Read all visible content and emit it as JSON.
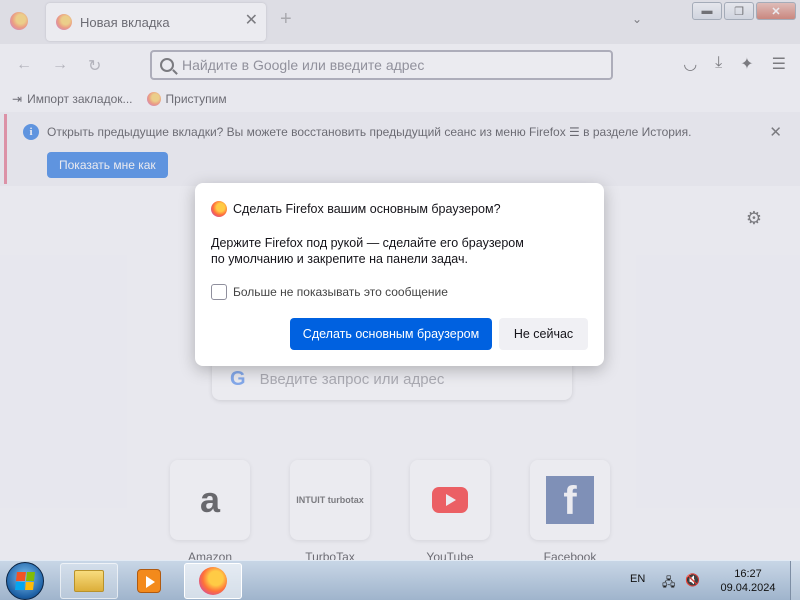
{
  "tabs": [
    {
      "title": "Новая вкладка",
      "close": "✕"
    }
  ],
  "tabbar": {
    "new_tab": "+",
    "tab_list": "⌄"
  },
  "window_controls": {
    "minimize": "▬",
    "maximize": "❐",
    "close": "✕"
  },
  "nav": {
    "back": "←",
    "forward": "→",
    "reload": "↻",
    "url_placeholder": "Найдите в Google или введите адрес",
    "pocket": "◡",
    "downloads": "⤓",
    "extensions": "✦",
    "menu": "☰"
  },
  "bookmarks": [
    {
      "label": "Импорт закладок...",
      "icon": "import-icon"
    },
    {
      "label": "Приступим",
      "icon": "firefox-icon"
    }
  ],
  "notification": {
    "text": "Открыть предыдущие вкладки? Вы можете восстановить предыдущий сеанс из меню Firefox ☰ в разделе История.",
    "info": "i",
    "button": "Показать мне как",
    "close": "✕"
  },
  "newtab": {
    "search_placeholder": "Введите запрос или адрес",
    "google_glyph": "G",
    "gear": "⚙",
    "shortcuts": [
      {
        "label": "Amazon",
        "logo": "a"
      },
      {
        "label": "TurboTax",
        "logo": "INTUIT turbotax"
      },
      {
        "label": "YouTube",
        "logo": ""
      },
      {
        "label": "Facebook",
        "logo": "f"
      }
    ]
  },
  "dialog": {
    "title": "Сделать Firefox вашим основным браузером?",
    "body": "Держите Firefox под рукой — сделайте его браузером по умолчанию и закрепите на панели задач.",
    "checkbox_label": "Больше не показывать это сообщение",
    "checkbox_checked": false,
    "primary_button": "Сделать основным браузером",
    "secondary_button": "Не сейчас"
  },
  "taskbar": {
    "language": "EN",
    "network": "🖧",
    "volume": "🔇",
    "time": "16:27",
    "date": "09.04.2024"
  },
  "colors": {
    "accent": "#0061e0",
    "notification_stripe": "#e35d7b"
  }
}
